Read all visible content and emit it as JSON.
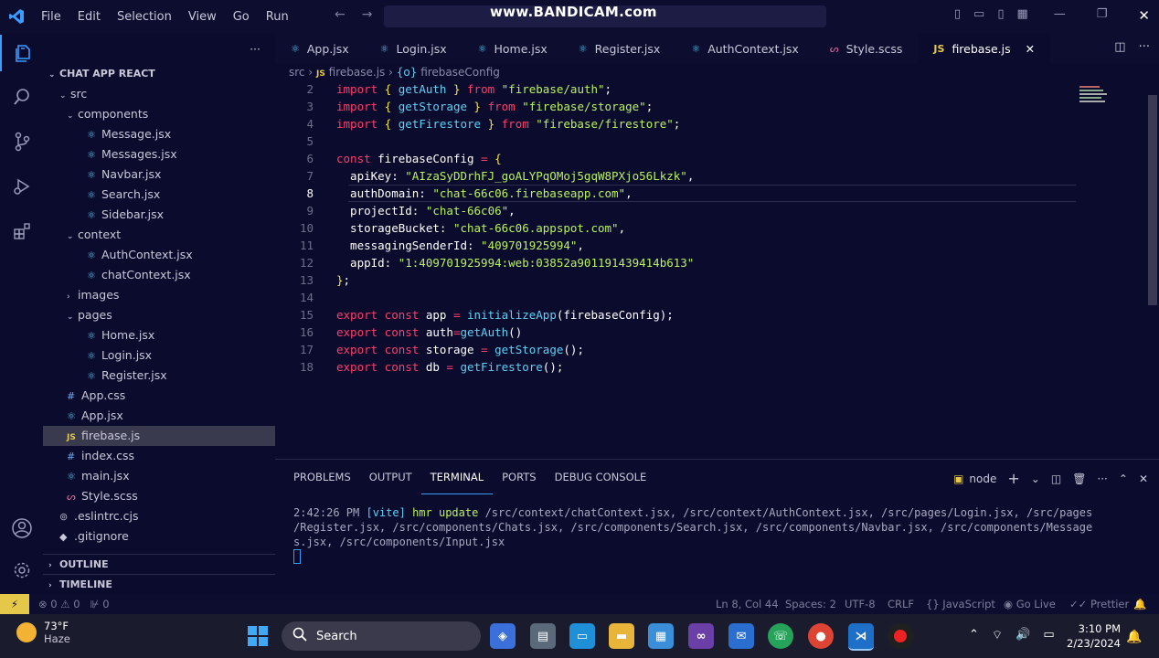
{
  "titlebar": {
    "menu": [
      "File",
      "Edit",
      "Selection",
      "View",
      "Go",
      "Run"
    ],
    "watermark": "www.BANDICAM.com"
  },
  "sidebar": {
    "project": "CHAT APP REACT",
    "tree": [
      {
        "label": "src",
        "depth": 1,
        "kind": "folder-open"
      },
      {
        "label": "components",
        "depth": 2,
        "kind": "folder-open"
      },
      {
        "label": "Message.jsx",
        "depth": 3,
        "kind": "react"
      },
      {
        "label": "Messages.jsx",
        "depth": 3,
        "kind": "react"
      },
      {
        "label": "Navbar.jsx",
        "depth": 3,
        "kind": "react"
      },
      {
        "label": "Search.jsx",
        "depth": 3,
        "kind": "react"
      },
      {
        "label": "Sidebar.jsx",
        "depth": 3,
        "kind": "react"
      },
      {
        "label": "context",
        "depth": 2,
        "kind": "folder-open"
      },
      {
        "label": "AuthContext.jsx",
        "depth": 3,
        "kind": "react"
      },
      {
        "label": "chatContext.jsx",
        "depth": 3,
        "kind": "react"
      },
      {
        "label": "images",
        "depth": 2,
        "kind": "folder-closed"
      },
      {
        "label": "pages",
        "depth": 2,
        "kind": "folder-open"
      },
      {
        "label": "Home.jsx",
        "depth": 3,
        "kind": "react"
      },
      {
        "label": "Login.jsx",
        "depth": 3,
        "kind": "react"
      },
      {
        "label": "Register.jsx",
        "depth": 3,
        "kind": "react"
      },
      {
        "label": "App.css",
        "depth": 2,
        "kind": "css"
      },
      {
        "label": "App.jsx",
        "depth": 2,
        "kind": "react"
      },
      {
        "label": "firebase.js",
        "depth": 2,
        "kind": "js",
        "selected": true
      },
      {
        "label": "index.css",
        "depth": 2,
        "kind": "css"
      },
      {
        "label": "main.jsx",
        "depth": 2,
        "kind": "react"
      },
      {
        "label": "Style.scss",
        "depth": 2,
        "kind": "sass"
      },
      {
        "label": ".eslintrc.cjs",
        "depth": 1,
        "kind": "gear"
      },
      {
        "label": ".gitignore",
        "depth": 1,
        "kind": "dot"
      }
    ],
    "outline": "OUTLINE",
    "timeline": "TIMELINE"
  },
  "tabs": [
    {
      "label": "App.jsx",
      "kind": "react"
    },
    {
      "label": "Login.jsx",
      "kind": "react"
    },
    {
      "label": "Home.jsx",
      "kind": "react"
    },
    {
      "label": "Register.jsx",
      "kind": "react"
    },
    {
      "label": "AuthContext.jsx",
      "kind": "react"
    },
    {
      "label": "Style.scss",
      "kind": "sass"
    },
    {
      "label": "firebase.js",
      "kind": "js",
      "active": true
    }
  ],
  "breadcrumb": {
    "root": "src",
    "file": "firebase.js",
    "symbol": "firebaseConfig"
  },
  "editor": {
    "current_line": 8,
    "lines": [
      {
        "n": 2,
        "tokens": [
          [
            "kw",
            "import "
          ],
          [
            "br",
            "{ "
          ],
          [
            "fn",
            "getAuth"
          ],
          [
            "br",
            " } "
          ],
          [
            "kw",
            "from "
          ],
          [
            "str",
            "\"firebase/auth\""
          ],
          [
            "id",
            ";"
          ]
        ]
      },
      {
        "n": 3,
        "tokens": [
          [
            "kw",
            "import "
          ],
          [
            "br",
            "{ "
          ],
          [
            "fn",
            "getStorage"
          ],
          [
            "br",
            " } "
          ],
          [
            "kw",
            "from "
          ],
          [
            "str",
            "\"firebase/storage\""
          ],
          [
            "id",
            ";"
          ]
        ]
      },
      {
        "n": 4,
        "tokens": [
          [
            "kw",
            "import "
          ],
          [
            "br",
            "{ "
          ],
          [
            "fn",
            "getFirestore"
          ],
          [
            "br",
            " } "
          ],
          [
            "kw",
            "from "
          ],
          [
            "str",
            "\"firebase/firestore\""
          ],
          [
            "id",
            ";"
          ]
        ]
      },
      {
        "n": 5,
        "tokens": []
      },
      {
        "n": 6,
        "tokens": [
          [
            "kw",
            "const "
          ],
          [
            "id",
            "firebaseConfig "
          ],
          [
            "op",
            "= "
          ],
          [
            "br",
            "{"
          ]
        ]
      },
      {
        "n": 7,
        "tokens": [
          [
            "id",
            "  apiKey: "
          ],
          [
            "str",
            "\"AIzaSyDDrhFJ_goALYPqOMoj5gqW8PXjo56Lkzk\""
          ],
          [
            "id",
            ","
          ]
        ]
      },
      {
        "n": 8,
        "tokens": [
          [
            "id",
            "  authDomain: "
          ],
          [
            "str",
            "\"chat-66c06.firebaseapp.com\""
          ],
          [
            "id",
            ","
          ]
        ]
      },
      {
        "n": 9,
        "tokens": [
          [
            "id",
            "  projectId: "
          ],
          [
            "str",
            "\"chat-66c06\""
          ],
          [
            "id",
            ","
          ]
        ]
      },
      {
        "n": 10,
        "tokens": [
          [
            "id",
            "  storageBucket: "
          ],
          [
            "str",
            "\"chat-66c06.appspot.com\""
          ],
          [
            "id",
            ","
          ]
        ]
      },
      {
        "n": 11,
        "tokens": [
          [
            "id",
            "  messagingSenderId: "
          ],
          [
            "str",
            "\"409701925994\""
          ],
          [
            "id",
            ","
          ]
        ]
      },
      {
        "n": 12,
        "tokens": [
          [
            "id",
            "  appId: "
          ],
          [
            "str",
            "\"1:409701925994:web:03852a901191439414b613\""
          ]
        ]
      },
      {
        "n": 13,
        "tokens": [
          [
            "br",
            "}"
          ],
          [
            "id",
            ";"
          ]
        ]
      },
      {
        "n": 14,
        "tokens": []
      },
      {
        "n": 15,
        "tokens": [
          [
            "kw",
            "export const "
          ],
          [
            "id",
            "app "
          ],
          [
            "op",
            "= "
          ],
          [
            "fn",
            "initializeApp"
          ],
          [
            "id",
            "(firebaseConfig);"
          ]
        ]
      },
      {
        "n": 16,
        "tokens": [
          [
            "kw",
            "export const "
          ],
          [
            "id",
            "auth"
          ],
          [
            "op",
            "="
          ],
          [
            "fn",
            "getAuth"
          ],
          [
            "id",
            "()"
          ]
        ]
      },
      {
        "n": 17,
        "tokens": [
          [
            "kw",
            "export const "
          ],
          [
            "id",
            "storage "
          ],
          [
            "op",
            "= "
          ],
          [
            "fn",
            "getStorage"
          ],
          [
            "id",
            "();"
          ]
        ]
      },
      {
        "n": 18,
        "tokens": [
          [
            "kw",
            "export const "
          ],
          [
            "id",
            "db "
          ],
          [
            "op",
            "= "
          ],
          [
            "fn",
            "getFirestore"
          ],
          [
            "id",
            "();"
          ]
        ]
      }
    ]
  },
  "panel": {
    "tabs": [
      "PROBLEMS",
      "OUTPUT",
      "TERMINAL",
      "PORTS",
      "DEBUG CONSOLE"
    ],
    "active_tab": "TERMINAL",
    "shell": "node",
    "terminal": {
      "time": "2:42:26 PM",
      "tag": "[vite]",
      "event": "hmr update",
      "paths_1": "/src/context/chatContext.jsx, /src/context/AuthContext.jsx, /src/pages/Login.jsx, /src/pages",
      "paths_2": "/Register.jsx, /src/components/Chats.jsx, /src/components/Search.jsx, /src/components/Navbar.jsx, /src/components/Message",
      "paths_3": "s.jsx, /src/components/Input.jsx"
    }
  },
  "statusbar": {
    "errors": "0",
    "warnings": "0",
    "ports": "0",
    "position": "Ln 8, Col 44",
    "spaces": "Spaces: 2",
    "encoding": "UTF-8",
    "eol": "CRLF",
    "language": "JavaScript",
    "golive": "Go Live",
    "prettier": "Prettier"
  },
  "taskbar": {
    "temp": "73°F",
    "condition": "Haze",
    "search": "Search",
    "time": "3:10 PM",
    "date": "2/23/2024"
  }
}
